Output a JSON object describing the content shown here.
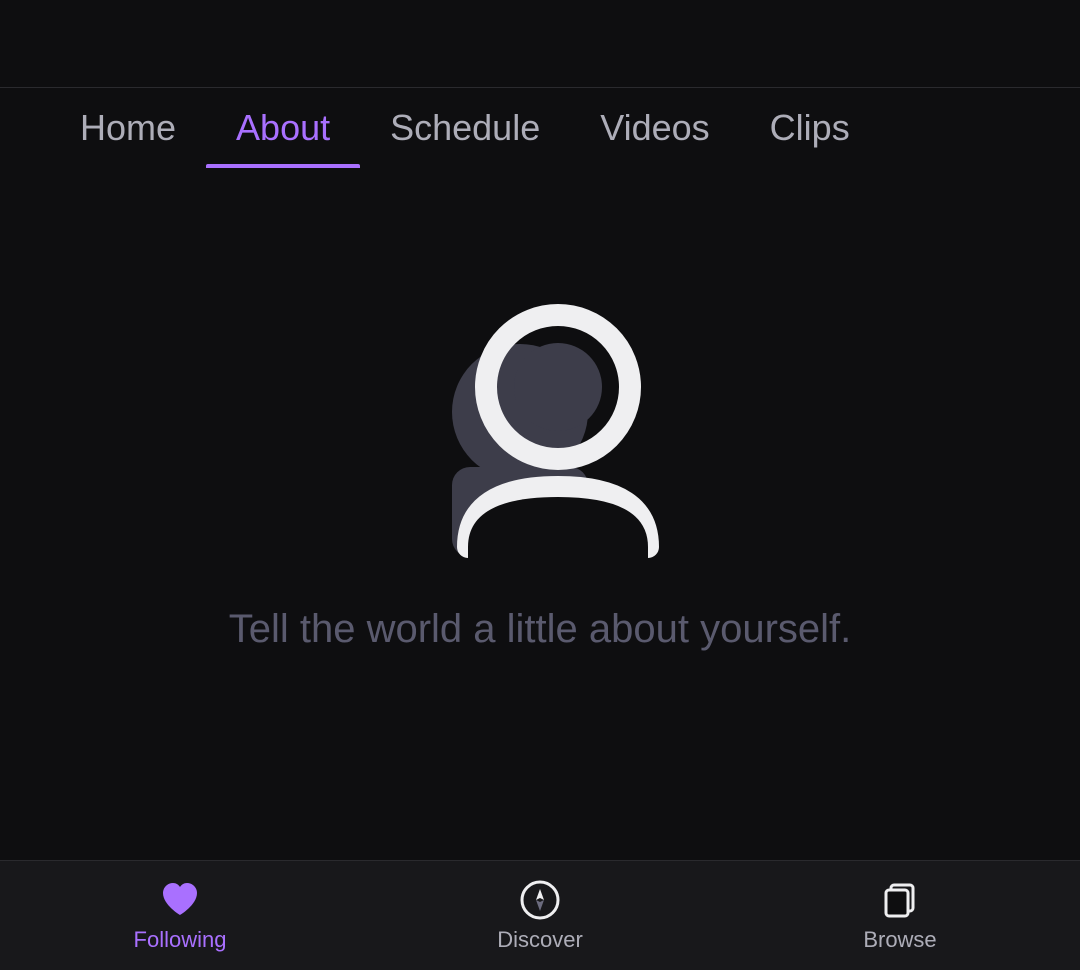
{
  "topBar": {
    "borderColor": "#2a2a2e"
  },
  "nav": {
    "tabs": [
      {
        "id": "home",
        "label": "Home",
        "active": false
      },
      {
        "id": "about",
        "label": "About",
        "active": true
      },
      {
        "id": "schedule",
        "label": "Schedule",
        "active": false
      },
      {
        "id": "videos",
        "label": "Videos",
        "active": false
      },
      {
        "id": "clips",
        "label": "Clips",
        "active": false
      }
    ]
  },
  "main": {
    "tagline": "Tell the world a little about yourself."
  },
  "bottomNav": {
    "items": [
      {
        "id": "following",
        "label": "Following",
        "icon": "heart",
        "active": true
      },
      {
        "id": "discover",
        "label": "Discover",
        "icon": "compass",
        "active": false
      },
      {
        "id": "browse",
        "label": "Browse",
        "icon": "browse",
        "active": false
      }
    ]
  }
}
